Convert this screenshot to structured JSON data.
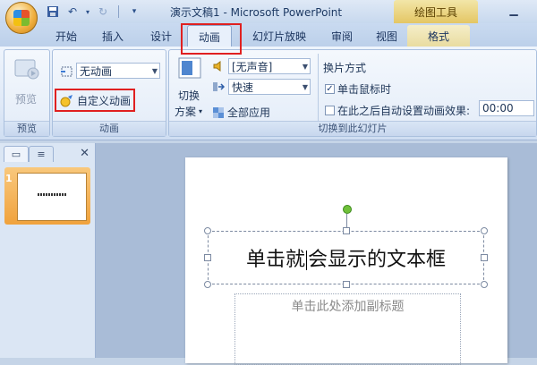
{
  "title_bar": {
    "title": "演示文稿1 - Microsoft PowerPoint",
    "context_tool": "绘图工具"
  },
  "tabs": [
    "开始",
    "插入",
    "设计",
    "动画",
    "幻灯片放映",
    "审阅",
    "视图",
    "格式"
  ],
  "ribbon": {
    "preview_group": {
      "button": "预览",
      "label": "预览"
    },
    "animation_group": {
      "animate_dropdown": "无动画",
      "custom_animation": "自定义动画",
      "label": "动画"
    },
    "transition_group": {
      "switch_scheme_line1": "切换",
      "switch_scheme_line2": "方案",
      "sound_dropdown": "[无声音]",
      "speed_dropdown": "快速",
      "apply_all": "全部应用",
      "advance_title": "换片方式",
      "on_click": "单击鼠标时",
      "auto_after": "在此之后自动设置动画效果:",
      "auto_time": "00:00",
      "label": "切换到此幻灯片"
    }
  },
  "slide_panel": {
    "slide_number": "1"
  },
  "slide": {
    "title_part1": "单击就",
    "title_part2": "会显示的文本框",
    "subtitle_placeholder": "单击此处添加副标题"
  },
  "colors": {
    "highlight": "#e02020",
    "thumb_selected": "#f0a23d"
  }
}
